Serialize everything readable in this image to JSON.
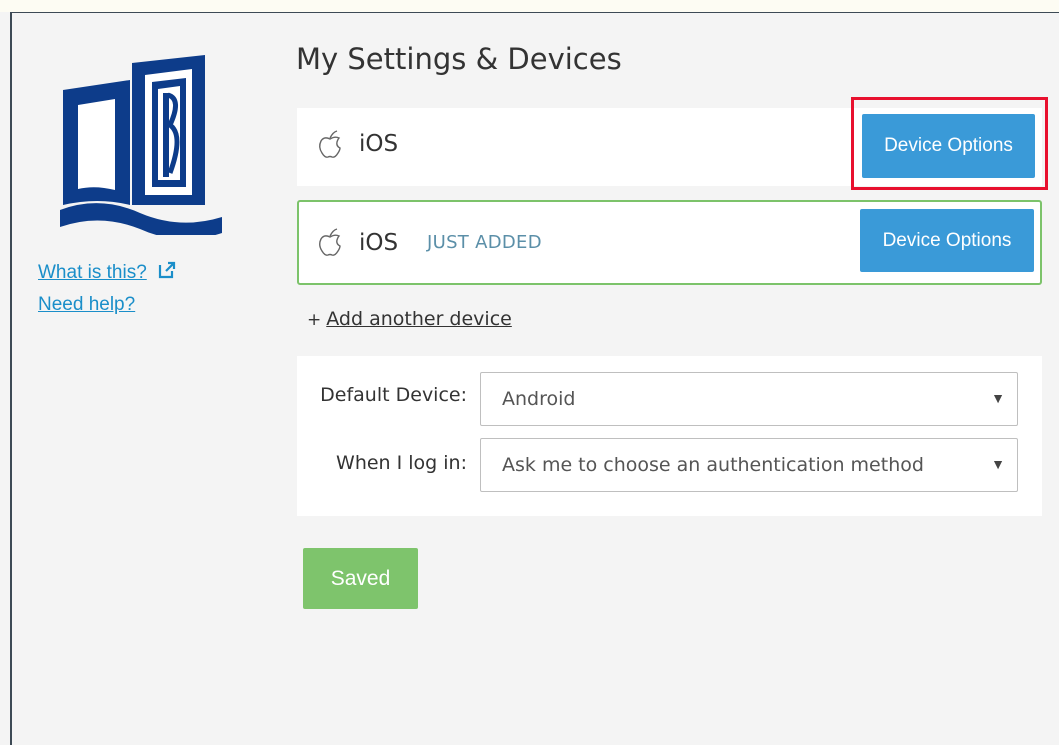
{
  "sidebar": {
    "links": [
      "What is this?",
      "Need help?"
    ]
  },
  "page": {
    "title": "My Settings & Devices"
  },
  "devices": [
    {
      "name": "iOS",
      "tag": "",
      "button_label": "Device Options"
    },
    {
      "name": "iOS",
      "tag": "JUST ADDED",
      "button_label": "Device Options"
    }
  ],
  "add_device": {
    "plus": "+",
    "label": "Add another device"
  },
  "settings": {
    "default_device": {
      "label": "Default Device:",
      "value": "Android"
    },
    "login": {
      "label": "When I log in:",
      "value": "Ask me to choose an authentication method"
    },
    "arrow": "▼"
  },
  "save_button": {
    "label": "Saved"
  },
  "colors": {
    "brand_blue": "#0d3c8a",
    "button_blue": "#3a9ad8",
    "success_green": "#7ec46c",
    "highlight_red": "#e8102e",
    "link_blue": "#1a8ec9"
  },
  "icons": {
    "logo": "open-book-logo",
    "external": "external-link-icon",
    "device": "apple-icon"
  }
}
